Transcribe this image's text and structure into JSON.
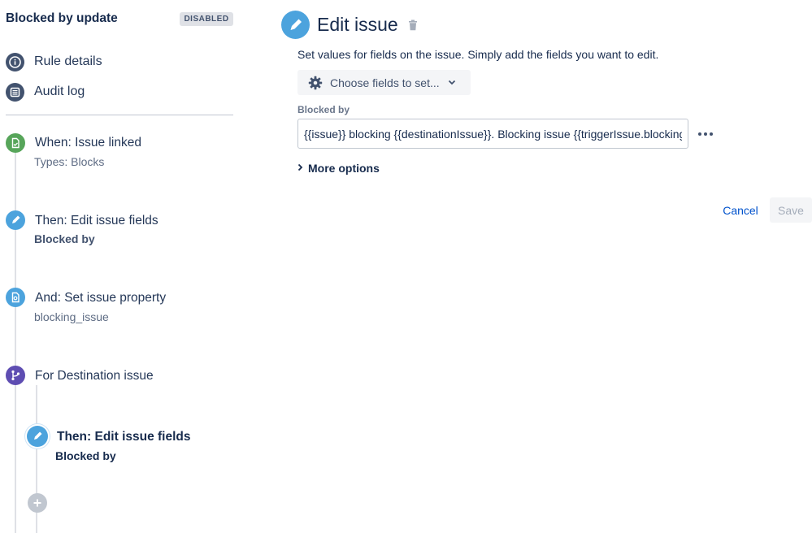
{
  "rule": {
    "title": "Blocked by update",
    "status_badge": "DISABLED"
  },
  "nav": {
    "rule_details": "Rule details",
    "audit_log": "Audit log"
  },
  "steps": [
    {
      "title": "When: Issue linked",
      "subtitle": "Types: Blocks",
      "icon": "document-trigger-icon",
      "color": "#57a55a"
    },
    {
      "title": "Then: Edit issue fields",
      "subtitle": "Blocked by",
      "icon": "pencil-icon",
      "color": "#4ca3dd"
    },
    {
      "title": "And: Set issue property",
      "subtitle": "blocking_issue",
      "icon": "property-icon",
      "color": "#4ca3dd"
    },
    {
      "title": "For Destination issue",
      "subtitle": "",
      "icon": "branch-icon",
      "color": "#5e4db2"
    },
    {
      "title": "Then: Edit issue fields",
      "subtitle": "Blocked by",
      "icon": "pencil-icon",
      "color": "#4ca3dd",
      "selected": true
    }
  ],
  "editor": {
    "title": "Edit issue",
    "description": "Set values for fields on the issue. Simply add the fields you want to edit.",
    "choose_fields_label": "Choose fields to set...",
    "field_label": "Blocked by",
    "field_value": "{{issue}} blocking {{destinationIssue}}. Blocking issue {{triggerIssue.blocking_issue}}",
    "more_options_label": "More options",
    "cancel_label": "Cancel",
    "save_label": "Save"
  },
  "colors": {
    "primary_blue": "#0052cc",
    "step_blue": "#4ca3dd",
    "trigger_green": "#57a55a",
    "branch_purple": "#5e4db2",
    "nav_icon": "#42526e"
  }
}
